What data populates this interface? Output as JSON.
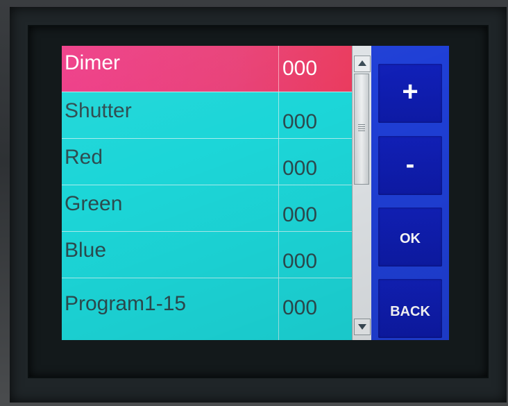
{
  "channels": [
    {
      "name": "Dimer",
      "value": "000",
      "selected": true
    },
    {
      "name": "Shutter",
      "value": "000",
      "selected": false
    },
    {
      "name": "Red",
      "value": "000",
      "selected": false
    },
    {
      "name": "Green",
      "value": "000",
      "selected": false
    },
    {
      "name": "Blue",
      "value": "000",
      "selected": false
    },
    {
      "name": "Program1-15",
      "value": "000",
      "selected": false
    }
  ],
  "buttons": {
    "plus": "+",
    "minus": "-",
    "ok": "OK",
    "back": "BACK"
  },
  "colors": {
    "list_bg": "#1cd6d8",
    "selected_row": "#ea3b7a",
    "button_panel": "#1f3fd6",
    "button": "#0d1aa6"
  },
  "icons": {
    "scroll_up": "triangle-up",
    "scroll_down": "triangle-down"
  }
}
